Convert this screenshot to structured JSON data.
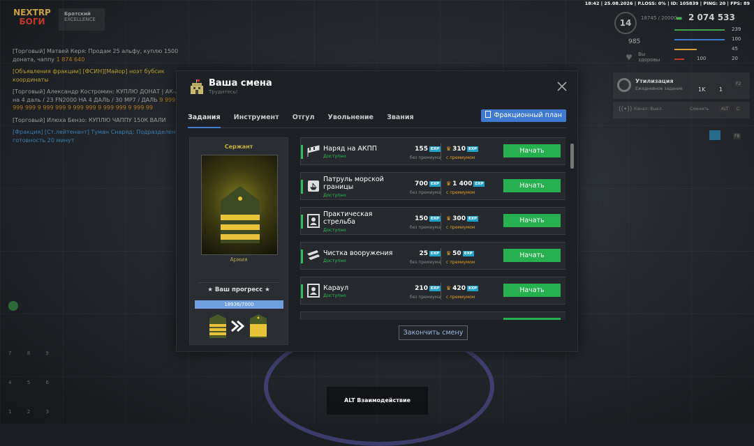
{
  "status_bar": "18:42 | 25.08.2026 | P.LOSS: 0% | ID: 105839 | PING: 20 | FPS: 89",
  "logo": {
    "line1": "NEXTRP",
    "line2": "БОГИ"
  },
  "server": {
    "name": "Братский",
    "subtitle": "EXCELLENCE"
  },
  "chat": [
    {
      "text": "[Торговый] Матвей Керя: Продам 25 альфу, куплю 1500 доната, чаппу",
      "extra": "1 874 640",
      "color": "gray"
    },
    {
      "text": "[Объявления фракции] [ФСИН][Майор] ноэт бубсик координаты",
      "color": "yellow"
    },
    {
      "text": "[Торговый] Александр Костромин: КУПЛЮ ДОНАТ | АК-Альфа на 4 даль / 23 FN2000 НА 4 ДАЛЬ / 30 МР7 / ДАЛЬ",
      "extra": "9 999 999 9 999 999 9 999 999 9 999 999 9 999 999 9 999 99",
      "color": "gray"
    },
    {
      "text": "[Торговый] Илюха Бензо: КУПЛЮ ЧАППУ 150К ВАЛИ",
      "color": "gray"
    },
    {
      "text": "[Фракция] [Ст.лейтенант] Туман Снаряд: Подразделение готовность 20 минут",
      "color": "blue"
    }
  ],
  "hud": {
    "level": "14",
    "level_sub": "18745 / 20000",
    "money": "2 074 533",
    "stat_985": "985",
    "hunger_label": "Вы здоровы",
    "stats": [
      {
        "icon": "pulse-icon",
        "value": "239",
        "color": "#3fa34d"
      },
      {
        "icon": "energy-icon",
        "value": "100",
        "color": "#3b7bd8"
      },
      {
        "icon": "thirst-icon",
        "value": "45",
        "color": "#d8a030"
      },
      {
        "icon": "hunger-icon",
        "value": "20",
        "color": "#c0392b"
      }
    ],
    "armor": "100",
    "utilization": {
      "title": "Утилизация",
      "subtitle": "Ежедневное задание",
      "count": "1K",
      "count2": "1",
      "key": "F2"
    },
    "channel": {
      "label": "Канал: Выкл.",
      "switch_label": "Сменить",
      "keys": [
        "ALT",
        "C"
      ]
    },
    "key_f8": "F8"
  },
  "modal": {
    "title": "Ваша смена",
    "subtitle": "Трудитесь!",
    "tabs": [
      "Задания",
      "Инструмент",
      "Отгул",
      "Увольнение",
      "Звания"
    ],
    "plan_button": "Фракционный план",
    "rank": {
      "title": "Сержант",
      "faction": "Армия",
      "progress_label": "★ Ваш прогресс ★",
      "progress_text": "18936/7000",
      "progress_fraction": 1.0
    },
    "exp_badge": "EXP",
    "without_premium": "без премиума",
    "with_premium": "с премиумом",
    "start_label": "Начать",
    "tasks": [
      {
        "name": "Наряд на АКПП",
        "status": "Доступно",
        "exp": "155",
        "exp_premium": "310",
        "icon": "gates-icon"
      },
      {
        "name": "Патруль морской\nграницы",
        "status": "Доступно",
        "exp": "700",
        "exp_premium": "1 400",
        "icon": "boat-icon"
      },
      {
        "name": "Практическая\nстрельба",
        "status": "Доступно",
        "exp": "150",
        "exp_premium": "300",
        "icon": "target-icon"
      },
      {
        "name": "Чистка вооружения",
        "status": "Доступно",
        "exp": "25",
        "exp_premium": "50",
        "icon": "rifle-icon"
      },
      {
        "name": "Караул",
        "status": "Доступно",
        "exp": "210",
        "exp_premium": "420",
        "icon": "guard-icon"
      }
    ],
    "finish_button": "Закончить смену"
  },
  "interaction_hint": "ALT Взаимодействие",
  "numpad_keys": [
    "7",
    "8",
    "9",
    "4",
    "5",
    "6",
    "1",
    "2",
    "3"
  ]
}
